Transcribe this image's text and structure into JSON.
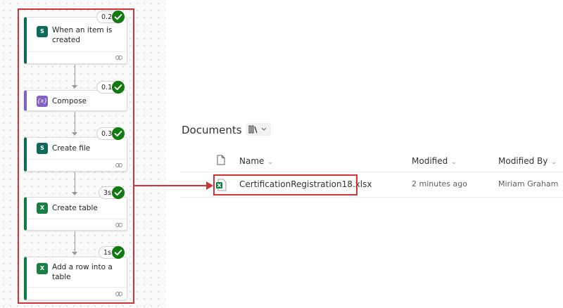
{
  "flow": {
    "steps": [
      {
        "title_line1": "When an item is",
        "title_line2": "created",
        "duration": "0.2s",
        "icon": "sharepoint-icon"
      },
      {
        "title_line1": "Compose",
        "duration": "0.1s",
        "icon": "compose-icon"
      },
      {
        "title_line1": "Create file",
        "duration": "0.3s",
        "icon": "sharepoint-icon"
      },
      {
        "title_line1": "Create table",
        "duration": "3s",
        "icon": "excel-icon"
      },
      {
        "title_line1": "Add a row into a",
        "title_line2": "table",
        "duration": "1s",
        "icon": "excel-icon"
      }
    ]
  },
  "documents": {
    "title": "Documents",
    "columns": {
      "name": "Name",
      "modified": "Modified",
      "modified_by": "Modified By"
    },
    "files": [
      {
        "name": "CertificationRegistration18.xlsx",
        "modified": "2 minutes ago",
        "modified_by": "Miriam Graham"
      }
    ]
  },
  "colors": {
    "highlight": "#d13438",
    "success": "#107c10",
    "sharepoint": "#0b6a53",
    "excel": "#107c41",
    "compose": "#8661c5"
  }
}
